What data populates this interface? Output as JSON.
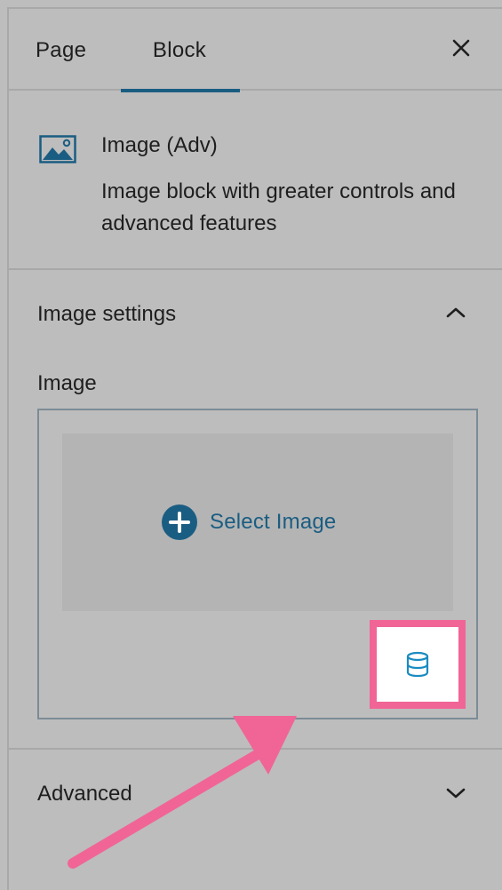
{
  "tabs": [
    {
      "label": "Page",
      "active": false
    },
    {
      "label": "Block",
      "active": true
    }
  ],
  "close_icon": "close-icon",
  "block": {
    "icon": "image-icon",
    "title": "Image (Adv)",
    "description": "Image block with greater controls and advanced features"
  },
  "image_settings": {
    "title": "Image settings",
    "expanded": true,
    "field_label": "Image",
    "select_label": "Select Image",
    "select_icon": "plus-circle-icon",
    "dynamic_source_icon": "database-icon"
  },
  "advanced": {
    "title": "Advanced",
    "expanded": false
  },
  "colors": {
    "accent": "#1a5d82",
    "highlight": "#f06596",
    "background": "#bdbdbd",
    "divider": "#a8a8a8"
  }
}
